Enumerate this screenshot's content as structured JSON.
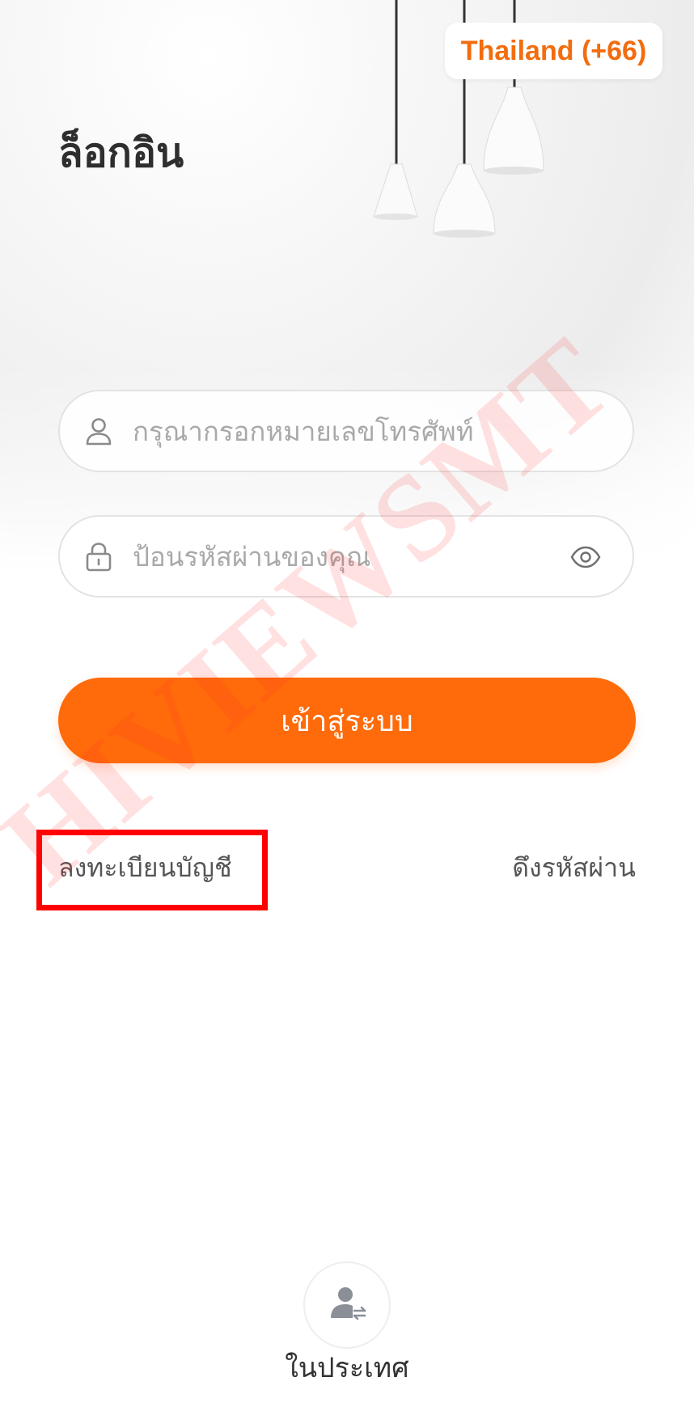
{
  "country_selector": {
    "label": "Thailand (+66)"
  },
  "title": "ล็อกอิน",
  "phone_field": {
    "placeholder": "กรุณากรอกหมายเลขโทรศัพท์",
    "icon": "user-icon"
  },
  "password_field": {
    "placeholder": "ป้อนรหัสผ่านของคุณ",
    "icon": "lock-icon",
    "toggle_icon": "eye-icon"
  },
  "login_button": {
    "label": "เข้าสู่ระบบ"
  },
  "links": {
    "register": "ลงทะเบียนบัญชี",
    "recover_password": "ดึงรหัสผ่าน"
  },
  "watermark": "HIVIEWSMT",
  "region_switch": {
    "label": "ในประเทศ",
    "icon": "user-switch-icon"
  },
  "colors": {
    "accent": "#ff6a0a",
    "country_text": "#f26d0f",
    "highlight": "#ff0000",
    "watermark": "#ff2a2a"
  }
}
